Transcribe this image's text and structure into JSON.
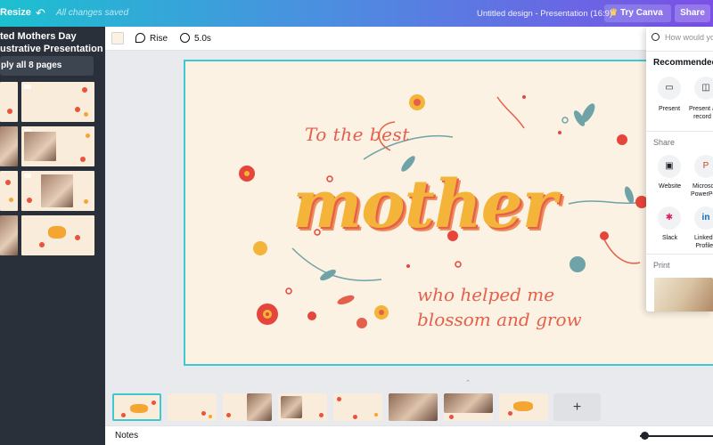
{
  "topbar": {
    "resize_label": "Resize",
    "undo_icon": "undo-arrow",
    "saved_status": "All changes saved",
    "doc_title": "Untitled design - Presentation (16:9)",
    "pro_label": "Try Canva Pro",
    "share_label": "Share"
  },
  "left_panel": {
    "template_title_line1": "ted Mothers Day",
    "template_title_line2": "ustrative Presentation",
    "apply_label": "ply all 8 pages"
  },
  "toolbar": {
    "background_color": "#fbf2e4",
    "animation_label": "Rise",
    "duration_label": "5.0s"
  },
  "slide": {
    "line1": "To the best",
    "headline": "mother",
    "line2a": "who helped me",
    "line2b": "blossom and grow",
    "border_color": "#3fc8d2",
    "accent_color": "#e5604a"
  },
  "filmstrip": {
    "add_label": "+"
  },
  "bottombar": {
    "notes_label": "Notes"
  },
  "share_panel": {
    "search_placeholder": "How would you",
    "recommended_heading": "Recommended",
    "present_label": "Present",
    "present_record_label_1": "Present a",
    "present_record_label_2": "record",
    "share_heading": "Share",
    "website_label": "Website",
    "ppt_label_1": "Microso",
    "ppt_label_2": "PowerPo",
    "slack_label": "Slack",
    "linkedin_label_1": "LinkedI",
    "linkedin_label_2": "Profile",
    "print_heading": "Print"
  }
}
